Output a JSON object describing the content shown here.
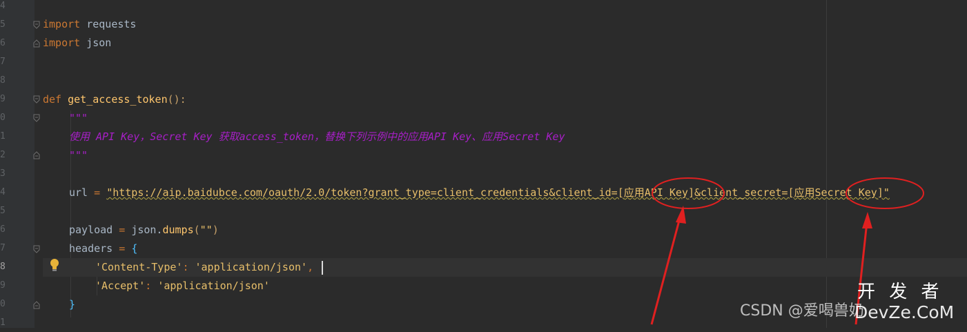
{
  "editor": {
    "line_numbers": [
      "4",
      "5",
      "6",
      "7",
      "8",
      "9",
      "10",
      "11",
      "12",
      "13",
      "14",
      "15",
      "16",
      "17",
      "18",
      "19",
      "20",
      "21"
    ],
    "code": {
      "l5_kw": "import",
      "l5_mod": " requests",
      "l6_kw": "import",
      "l6_mod": " json",
      "l9_kw": "def",
      "l9_name": "get_access_token",
      "l9_paren": "():",
      "l10_doc": "\"\"\"",
      "l11_doc": "使用 API Key，Secret Key 获取access_token，替换下列示例中的应用API Key、应用Secret Key",
      "l12_doc": "\"\"\"",
      "l14_var": "url",
      "l14_eq": " = ",
      "l14_str_a": "\"https://aip.baidubce.com/oauth/2.0/token?grant_type=client_credentials&client_id=[",
      "l14_str_b": "应用API Key",
      "l14_str_c": "]&client_secret=[",
      "l14_str_d": "应用Secret Key",
      "l14_str_e": "]\"",
      "l16_var": "payload",
      "l16_eq": " = ",
      "l16_obj": "json.",
      "l16_fn": "dumps",
      "l16_p1": "(",
      "l16_str": "\"\"",
      "l16_p2": ")",
      "l17_var": "headers",
      "l17_eq": " = ",
      "l17_brace": "{",
      "l18_key": "'Content-Type'",
      "l18_colon": ": ",
      "l18_val": "'application/json'",
      "l18_comma": ",",
      "l19_key": "'Accept'",
      "l19_colon": ": ",
      "l19_val": "'application/json'",
      "l20_brace": "}"
    }
  },
  "watermarks": {
    "csdn": "CSDN @爱喝兽奶",
    "kaifazhe": "开 发 者",
    "devze": "DevZe.CoM"
  },
  "colors": {
    "annotation": "#e02020",
    "keyword": "#cc7832",
    "docstring": "#a71fc7"
  }
}
